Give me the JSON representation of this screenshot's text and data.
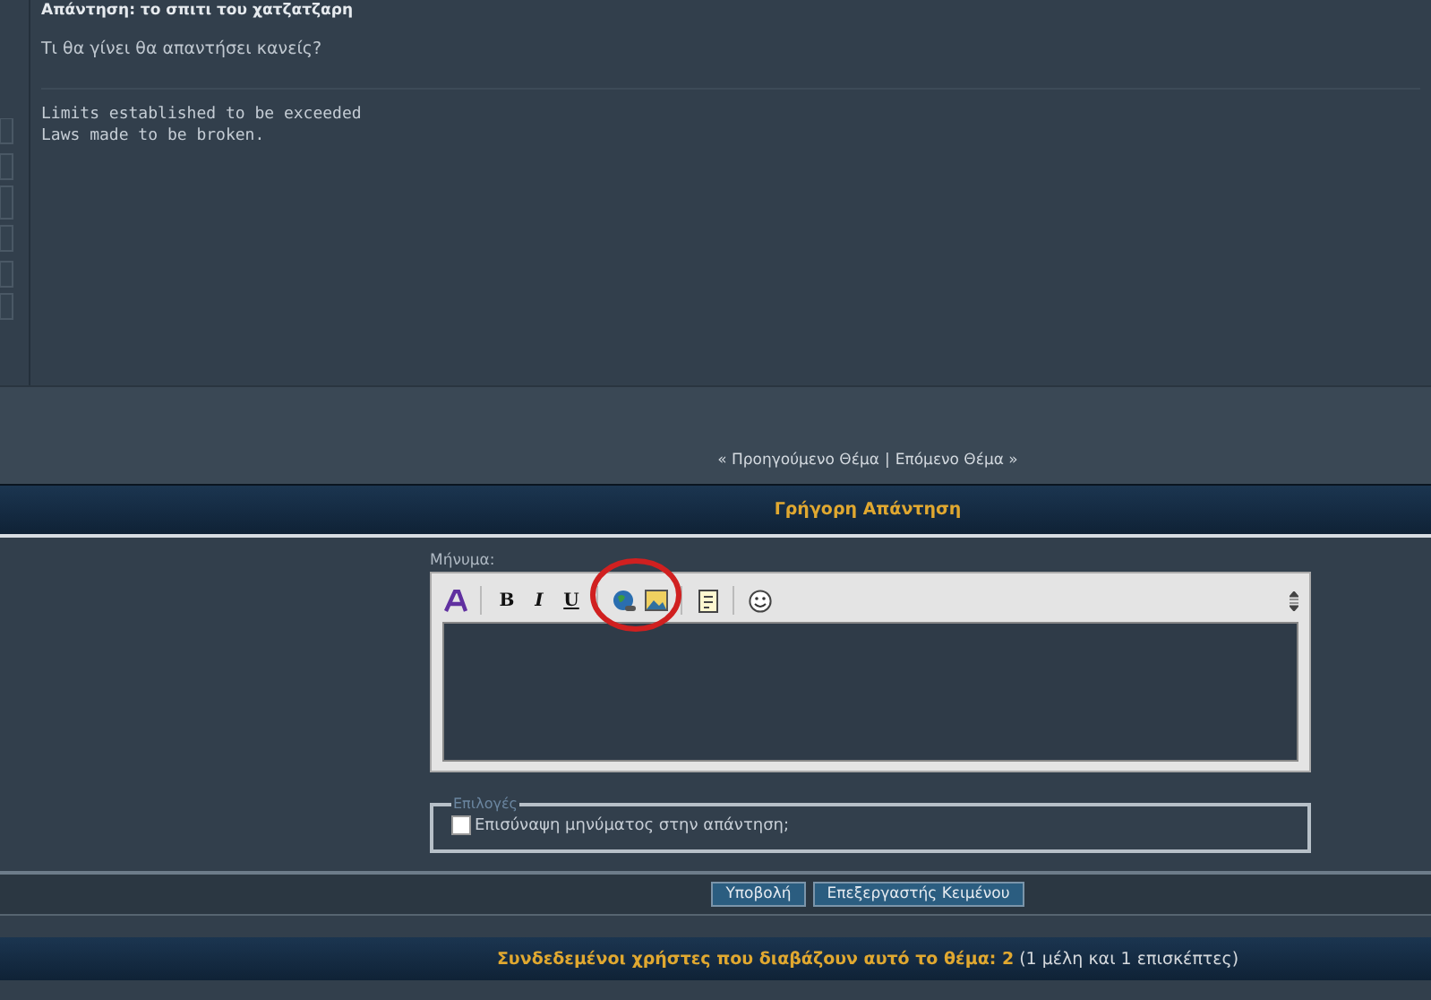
{
  "post": {
    "title": "Απάντηση: το σπιτι του χατζατζαρη",
    "body": "Τι θα γίνει θα απαντήσει κανείς?",
    "signature": [
      "Limits established to be exceeded",
      "Laws made to be broken."
    ]
  },
  "thread_nav": {
    "previous": "« Προηγούμενο Θέμα",
    "separator": "|",
    "next": "Επόμενο Θέμα »"
  },
  "quick_reply": {
    "title": "Γρήγορη Απάντηση",
    "message_label": "Μήνυμα:",
    "toolbar": [
      {
        "kind": "font-color"
      },
      {
        "kind": "sep"
      },
      {
        "kind": "bold",
        "label": "B"
      },
      {
        "kind": "italic",
        "label": "I"
      },
      {
        "kind": "underline",
        "label": "U"
      },
      {
        "kind": "sep"
      },
      {
        "kind": "link"
      },
      {
        "kind": "image"
      },
      {
        "kind": "sep"
      },
      {
        "kind": "quote"
      },
      {
        "kind": "sep"
      },
      {
        "kind": "smiley"
      }
    ],
    "options_legend": "Επιλογές",
    "quote_option": {
      "label": "Επισύναψη μηνύματος στην απάντηση;",
      "checked": false
    },
    "buttons": [
      "Υποβολή",
      "Επεξεργαστής Κειμένου"
    ]
  },
  "online": {
    "text": "**Συνδεδεμένοι χρήστες που διαβάζουν αυτό το θέμα: 2** (1 μέλη και 1 επισκέπτες)"
  }
}
